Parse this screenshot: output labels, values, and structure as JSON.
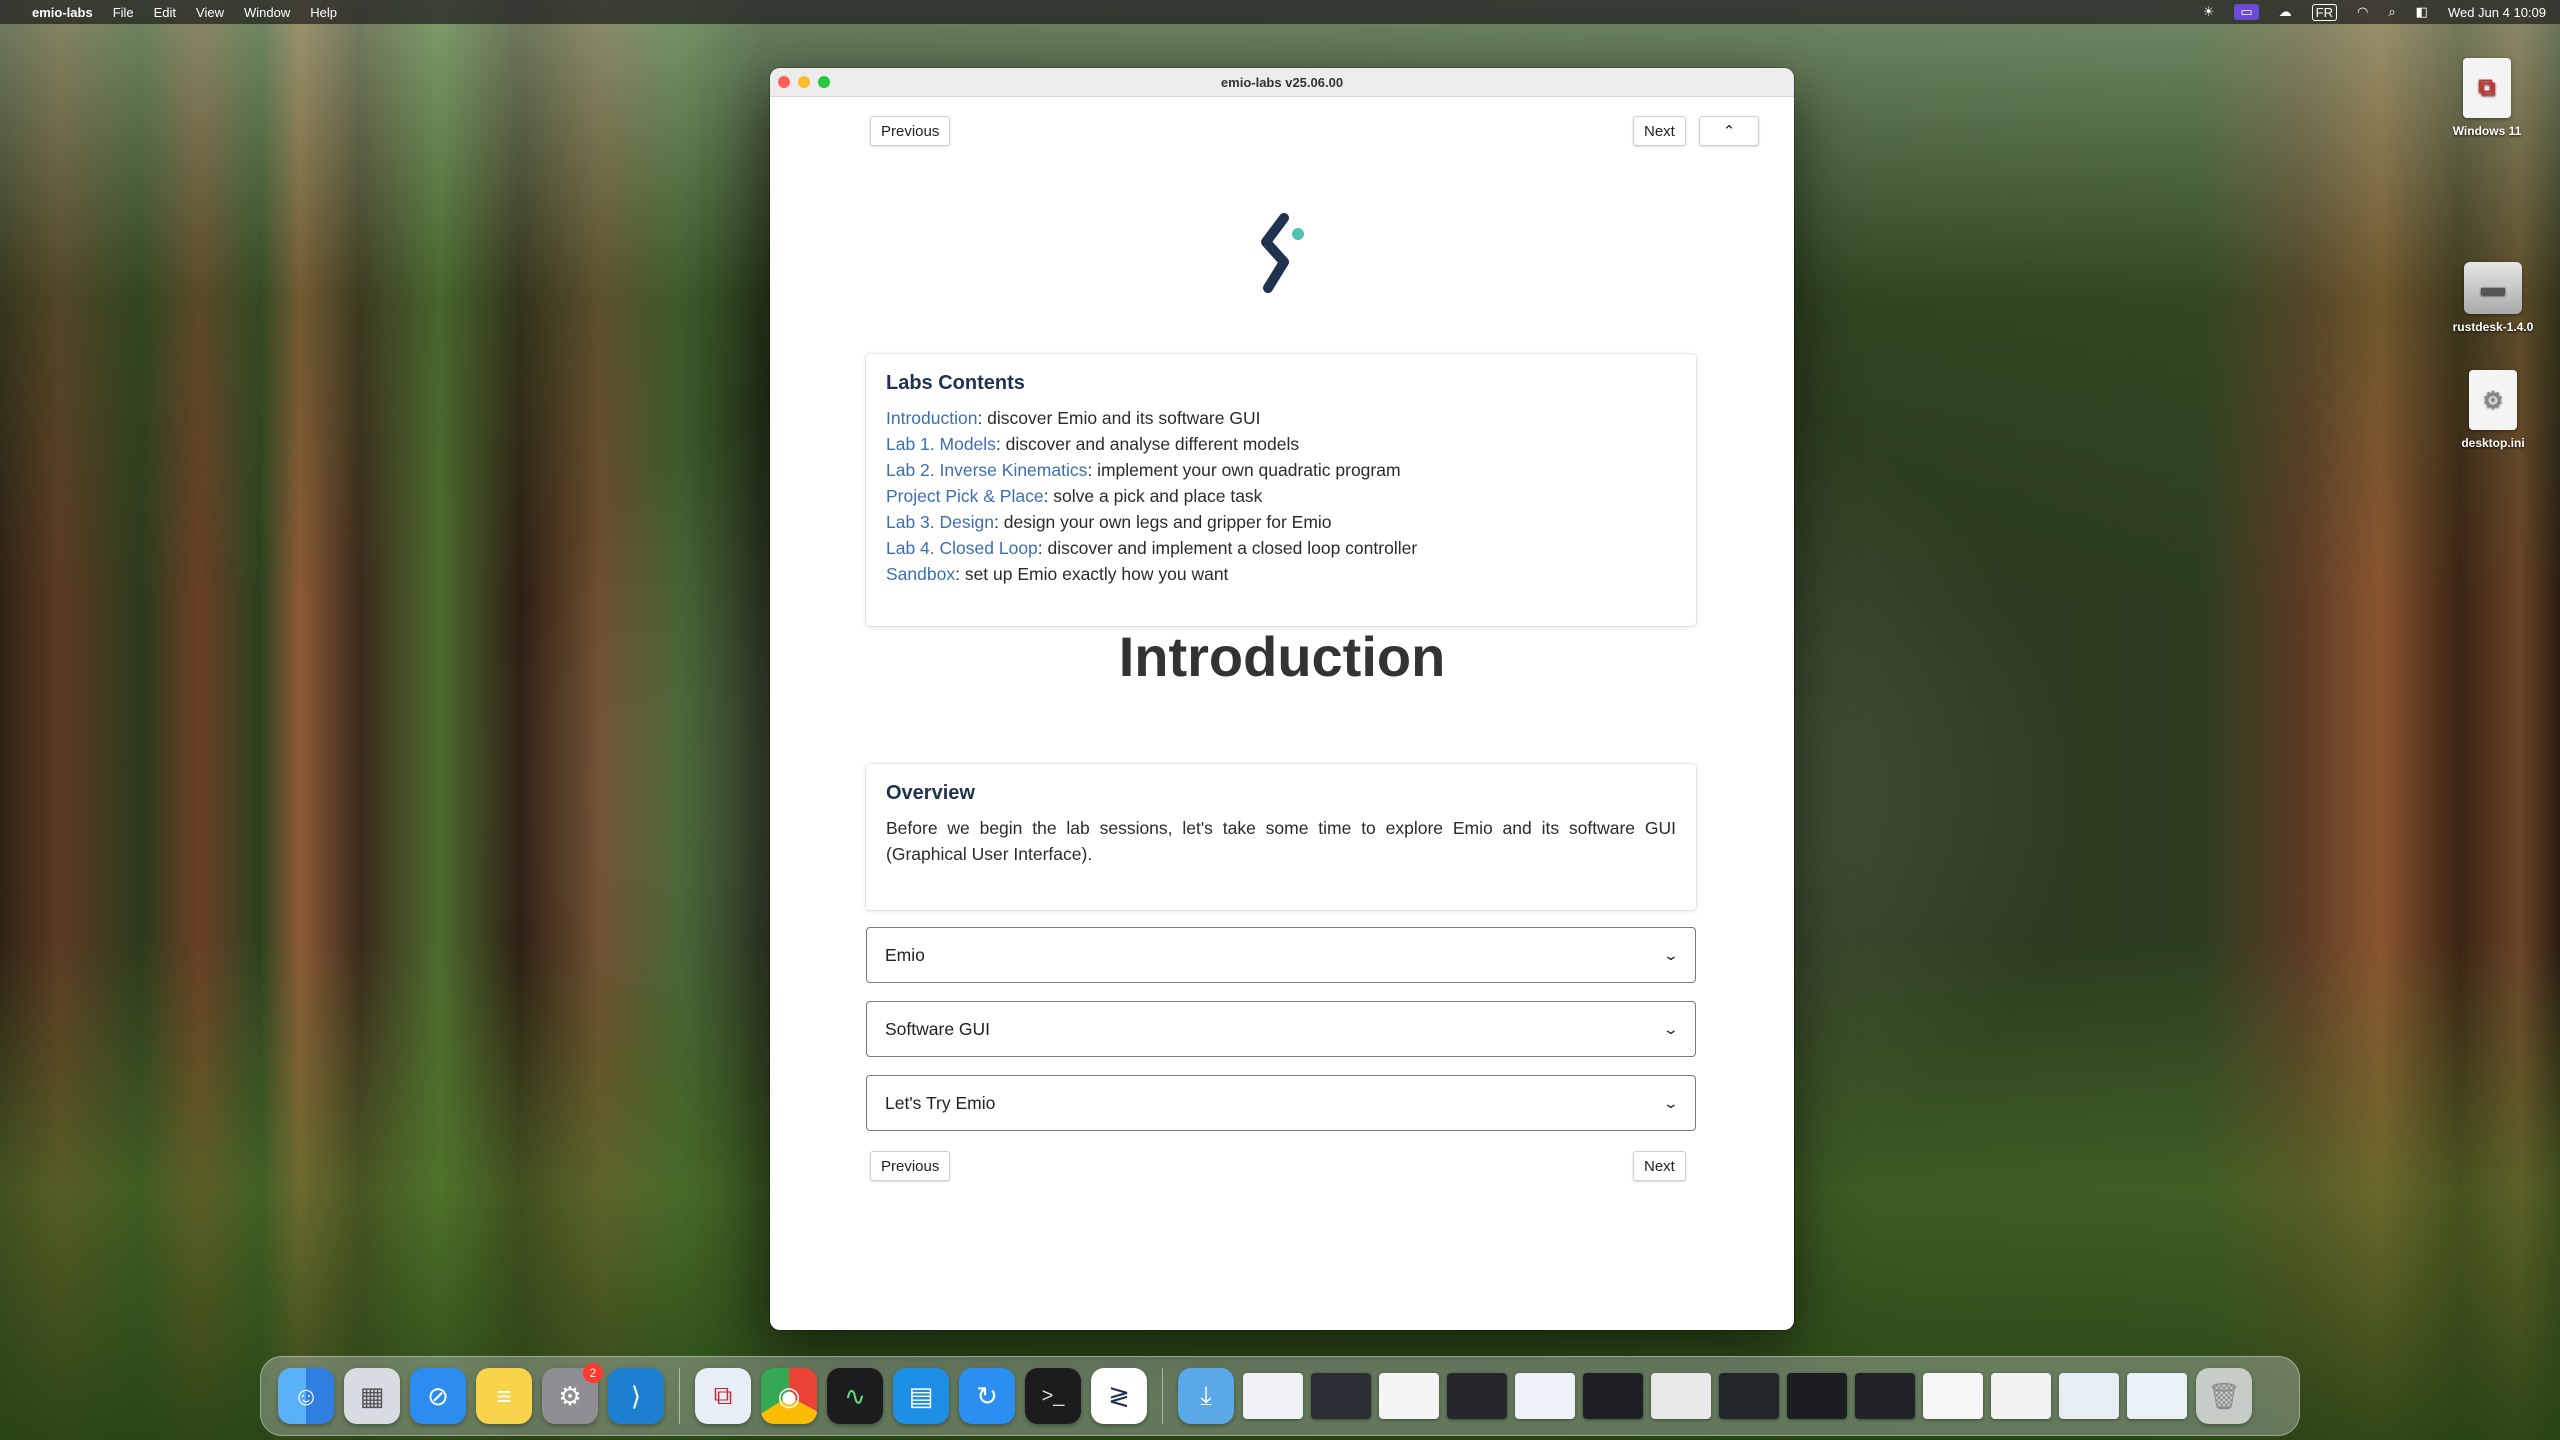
{
  "menubar": {
    "app_name": "emio-labs",
    "menus": [
      "File",
      "Edit",
      "View",
      "Window",
      "Help"
    ],
    "status": {
      "input_source": "FR",
      "datetime": "Wed Jun 4  10:09"
    }
  },
  "desktop": {
    "icons": [
      {
        "label": "Windows 11"
      },
      {
        "label": "rustdesk-1.4.0"
      },
      {
        "label": "desktop.ini"
      }
    ]
  },
  "window": {
    "title": "emio-labs v25.06.00",
    "nav": {
      "previous": "Previous",
      "next": "Next",
      "collapse_symbol": "⌃"
    },
    "labs_contents": {
      "heading": "Labs Contents",
      "items": [
        {
          "link": "Introduction",
          "desc": ": discover Emio and its software GUI"
        },
        {
          "link": "Lab 1. Models",
          "desc": ": discover and analyse different models"
        },
        {
          "link": "Lab 2. Inverse Kinematics",
          "desc": ": implement your own quadratic program"
        },
        {
          "link": "Project Pick & Place",
          "desc": ": solve a pick and place task"
        },
        {
          "link": "Lab 3. Design",
          "desc": ": design your own legs and gripper for Emio"
        },
        {
          "link": "Lab 4. Closed Loop",
          "desc": ": discover and implement a closed loop controller"
        },
        {
          "link": "Sandbox",
          "desc": ": set up Emio exactly how you want"
        }
      ]
    },
    "section_title": "Introduction",
    "overview": {
      "heading": "Overview",
      "text": "Before we begin the lab sessions, let's take some time to explore Emio and its software GUI (Graphical User Interface)."
    },
    "accordions": [
      {
        "label": "Emio"
      },
      {
        "label": "Software GUI"
      },
      {
        "label": "Let's Try Emio"
      }
    ]
  },
  "dock": {
    "notification_badge": "2"
  },
  "colors": {
    "link": "#3d6fb0",
    "heading": "#1f3350",
    "logo_dark": "#1f3350",
    "logo_accent": "#4fc3b0"
  }
}
